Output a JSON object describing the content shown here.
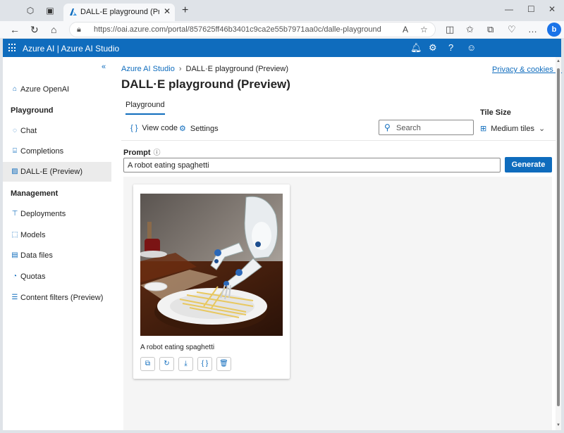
{
  "browser": {
    "tab_title": "DALL-E playground (Preview) | A...",
    "url": "https://oai.azure.com/portal/857625ff46b3401c9ca2e55b7971aa0c/dalle-playground",
    "bing_label": "b"
  },
  "header": {
    "brand": "Azure AI  |  Azure AI Studio",
    "accent": "#0f6cbd"
  },
  "sidebar": {
    "items": [
      {
        "label": "Azure OpenAI",
        "icon": "home-icon"
      },
      {
        "label": "Chat",
        "icon": "chat-icon"
      },
      {
        "label": "Completions",
        "icon": "completions-icon"
      },
      {
        "label": "DALL-E (Preview)",
        "icon": "image-icon"
      },
      {
        "label": "Deployments",
        "icon": "deployments-icon"
      },
      {
        "label": "Models",
        "icon": "models-icon"
      },
      {
        "label": "Data files",
        "icon": "data-files-icon"
      },
      {
        "label": "Quotas",
        "icon": "quotas-icon"
      },
      {
        "label": "Content filters (Preview)",
        "icon": "content-filters-icon"
      }
    ],
    "sections": {
      "playground": "Playground",
      "management": "Management"
    }
  },
  "breadcrumb": {
    "root": "Azure AI Studio",
    "current": "DALL·E playground (Preview)"
  },
  "privacy_link": "Privacy & cookies",
  "page_title": "DALL·E playground (Preview)",
  "tabs": {
    "playground": "Playground"
  },
  "toolbar": {
    "view_code": "View code",
    "settings": "Settings",
    "search_placeholder": "Search",
    "tile_size_label": "Tile Size",
    "tile_size_value": "Medium tiles"
  },
  "prompt": {
    "label": "Prompt",
    "value": "A robot eating spaghetti",
    "generate_button": "Generate"
  },
  "result": {
    "caption": "A robot eating spaghetti"
  }
}
